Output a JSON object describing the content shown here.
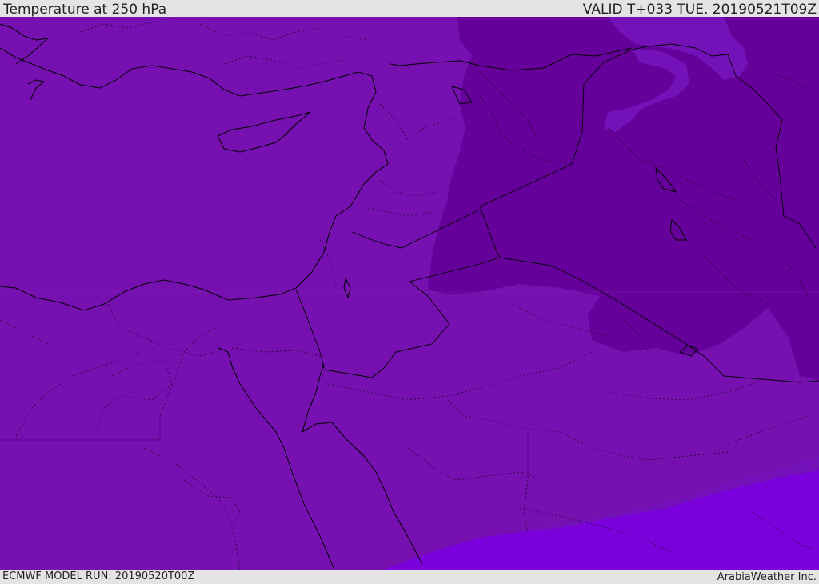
{
  "header": {
    "title": "Temperature at 250 hPa",
    "valid_time": "VALID T+033 TUE. 20190521T09Z"
  },
  "footer": {
    "model_run": "ECMWF MODEL RUN: 20190520T00Z",
    "credit": "ArabiaWeather Inc."
  },
  "colors": {
    "base_field": "#7610b0",
    "warm_region": "#66009a",
    "mid_band": "#7412ba",
    "cool_region": "#7a00dc",
    "coast_line": "#000000"
  }
}
